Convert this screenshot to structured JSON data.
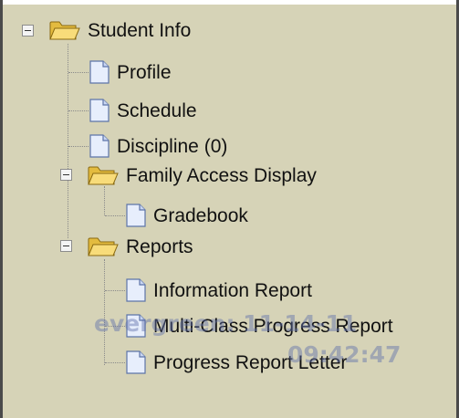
{
  "tree": {
    "root": {
      "label": "Student Info",
      "icon": "folder-open-icon"
    },
    "items": {
      "profile": {
        "label": "Profile",
        "icon": "document-icon"
      },
      "schedule": {
        "label": "Schedule",
        "icon": "document-icon"
      },
      "discipline": {
        "label": "Discipline (0)",
        "icon": "document-icon"
      },
      "family_access": {
        "label": "Family Access Display",
        "icon": "folder-open-icon"
      },
      "gradebook": {
        "label": "Gradebook",
        "icon": "document-icon"
      },
      "reports": {
        "label": "Reports",
        "icon": "folder-open-icon"
      },
      "information_report": {
        "label": "Information Report",
        "icon": "document-icon"
      },
      "multi_class": {
        "label": "Multi-Class Progress Report",
        "icon": "document-icon"
      },
      "progress_letter": {
        "label": "Progress Report Letter",
        "icon": "document-icon"
      }
    }
  },
  "watermark": {
    "line1": "evergreen: 11-14-11",
    "line2": "09:42:47"
  },
  "colors": {
    "panel_background": "#d6d3b7",
    "folder_fill": "#f5d873",
    "document_fill": "#e7eefc",
    "watermark": "#606eaa"
  }
}
